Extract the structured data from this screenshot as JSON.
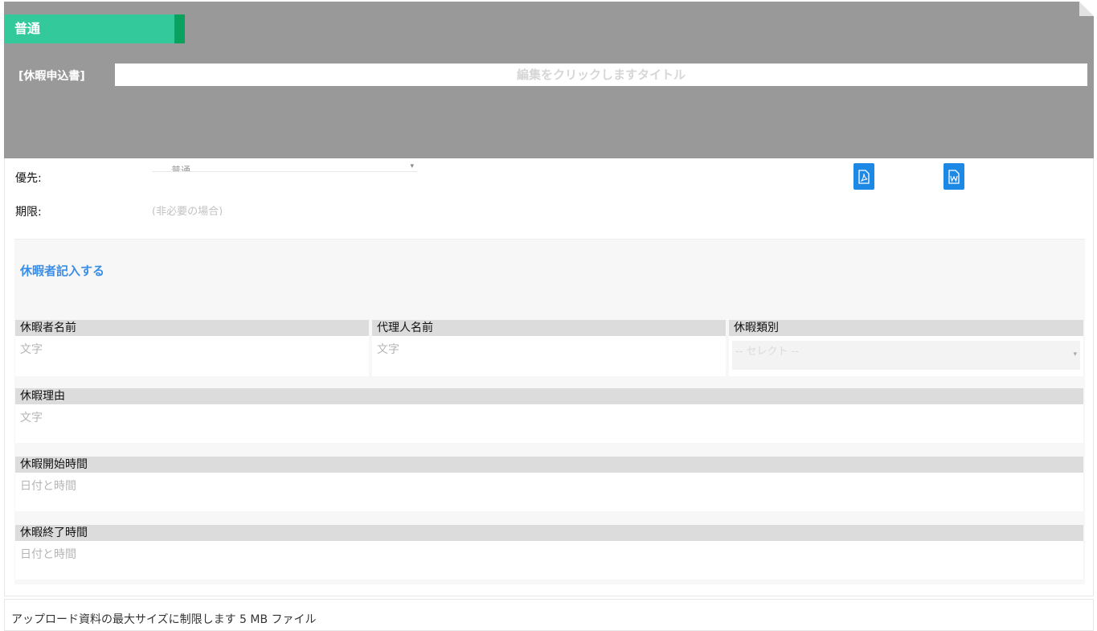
{
  "header": {
    "priority_tag": "普通",
    "doc_type": "[休暇申込書]",
    "title_placeholder": "編集をクリックしますタイトル",
    "colors": {
      "header_bg": "#999999",
      "tag_green": "#33c99b",
      "tag_dark_green": "#0aa25e"
    }
  },
  "meta": {
    "priority_label": "優先:",
    "priority_value": "普通",
    "deadline_label": "期限:",
    "deadline_value": "(非必要の場合)"
  },
  "downloads": {
    "pdf_icon": "pdf-file-icon",
    "word_icon": "word-file-icon",
    "accent": "#1e88e5"
  },
  "section": {
    "title": "休暇者記入する",
    "fields": {
      "applicant_name": {
        "label": "休暇者名前",
        "placeholder": "文字"
      },
      "proxy_name": {
        "label": "代理人名前",
        "placeholder": "文字"
      },
      "leave_type": {
        "label": "休暇類別",
        "placeholder": "-- セレクト --"
      },
      "reason": {
        "label": "休暇理由",
        "placeholder": "文字"
      },
      "start_time": {
        "label": "休暇開始時間",
        "placeholder": "日付と時間"
      },
      "end_time": {
        "label": "休暇終了時間",
        "placeholder": "日付と時間"
      }
    }
  },
  "footer": {
    "upload_note": "アップロード資料の最大サイズに制限します 5 MB ファイル"
  }
}
